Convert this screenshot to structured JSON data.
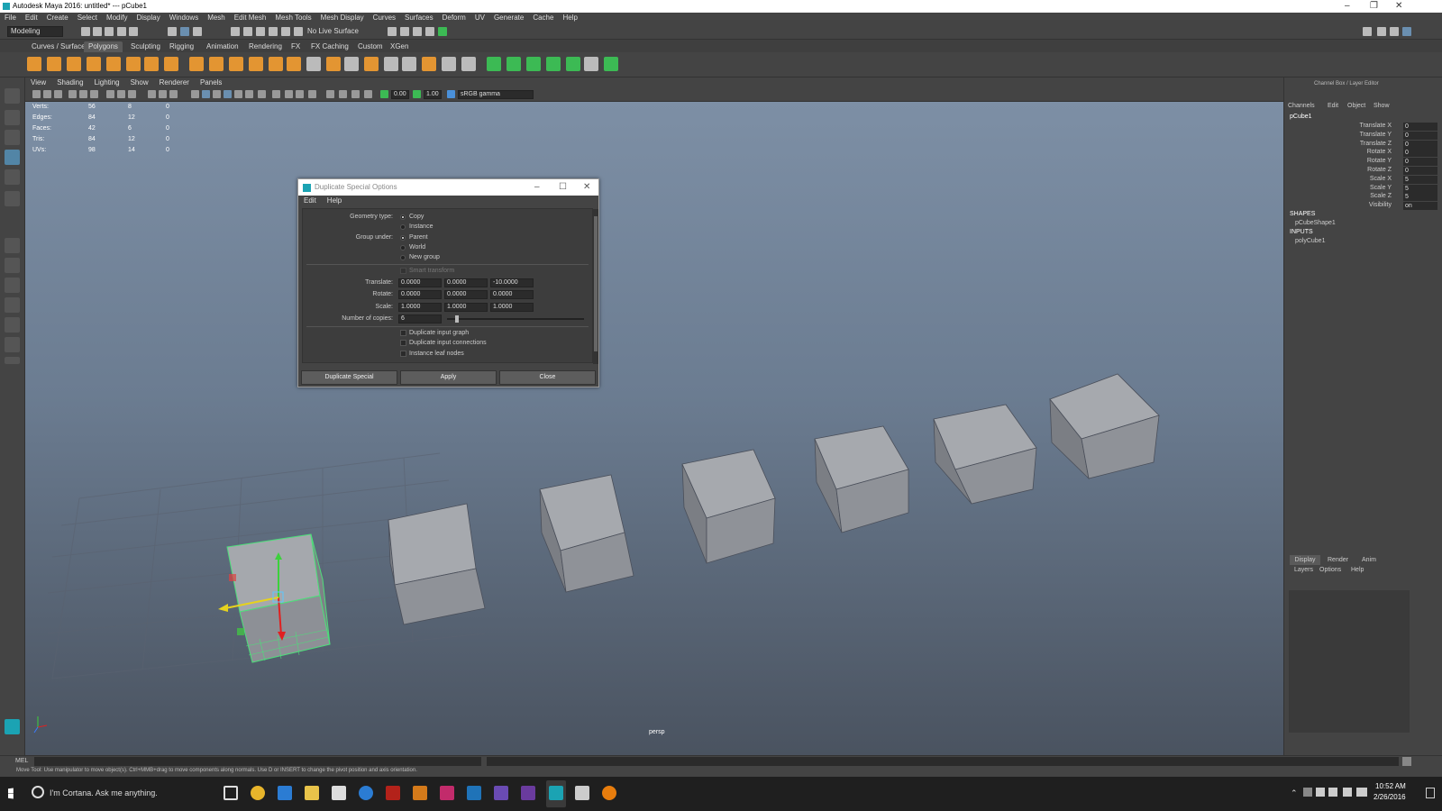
{
  "window": {
    "title": "Autodesk Maya 2016: untitled*   ---   pCube1"
  },
  "menubar": [
    "File",
    "Edit",
    "Create",
    "Select",
    "Modify",
    "Display",
    "Windows",
    "Mesh",
    "Edit Mesh",
    "Mesh Tools",
    "Mesh Display",
    "Curves",
    "Surfaces",
    "Deform",
    "UV",
    "Generate",
    "Cache",
    "Help"
  ],
  "status": {
    "menuset": "Modeling",
    "live": "No Live Surface"
  },
  "shelf_tabs": [
    "Curves / Surfaces",
    "Polygons",
    "Sculpting",
    "Rigging",
    "Animation",
    "Rendering",
    "FX",
    "FX Caching",
    "Custom",
    "XGen"
  ],
  "shelf_active": "Polygons",
  "viewport_menu": [
    "View",
    "Shading",
    "Lighting",
    "Show",
    "Renderer",
    "Panels"
  ],
  "viewport_toolbar": {
    "val1": "0.00",
    "val2": "1.00",
    "colorspace": "sRGB gamma"
  },
  "hud": [
    {
      "label": "Verts:",
      "a": "56",
      "b": "8",
      "c": "0"
    },
    {
      "label": "Edges:",
      "a": "84",
      "b": "12",
      "c": "0"
    },
    {
      "label": "Faces:",
      "a": "42",
      "b": "6",
      "c": "0"
    },
    {
      "label": "Tris:",
      "a": "84",
      "b": "12",
      "c": "0"
    },
    {
      "label": "UVs:",
      "a": "98",
      "b": "14",
      "c": "0"
    }
  ],
  "camera": "persp",
  "dialog": {
    "title": "Duplicate Special Options",
    "menu": [
      "Edit",
      "Help"
    ],
    "geometry_label": "Geometry type:",
    "geometry_options": [
      "Copy",
      "Instance"
    ],
    "group_label": "Group under:",
    "group_options": [
      "Parent",
      "World",
      "New group"
    ],
    "smart_transform": "Smart transform",
    "translate_label": "Translate:",
    "translate": [
      "0.0000",
      "0.0000",
      "-10.0000"
    ],
    "rotate_label": "Rotate:",
    "rotate": [
      "0.0000",
      "0.0000",
      "0.0000"
    ],
    "scale_label": "Scale:",
    "scale": [
      "1.0000",
      "1.0000",
      "1.0000"
    ],
    "copies_label": "Number of copies:",
    "copies": "6",
    "copies_fraction": 0.06,
    "checks": [
      "Duplicate input graph",
      "Duplicate input connections",
      "Instance leaf nodes"
    ],
    "buttons": [
      "Duplicate Special",
      "Apply",
      "Close"
    ]
  },
  "channelbox": {
    "title": "Channel Box / Layer Editor",
    "menu": [
      "Channels",
      "Edit",
      "Object",
      "Show"
    ],
    "object": "pCube1",
    "attrs": [
      {
        "n": "Translate X",
        "v": "0"
      },
      {
        "n": "Translate Y",
        "v": "0"
      },
      {
        "n": "Translate Z",
        "v": "0"
      },
      {
        "n": "Rotate X",
        "v": "0"
      },
      {
        "n": "Rotate Y",
        "v": "0"
      },
      {
        "n": "Rotate Z",
        "v": "0"
      },
      {
        "n": "Scale X",
        "v": "5"
      },
      {
        "n": "Scale Y",
        "v": "5"
      },
      {
        "n": "Scale Z",
        "v": "5"
      },
      {
        "n": "Visibility",
        "v": "on"
      }
    ],
    "shapes_h": "SHAPES",
    "shape": "pCubeShape1",
    "inputs_h": "INPUTS",
    "input": "polyCube1",
    "layer_tabs": [
      "Display",
      "Render",
      "Anim"
    ],
    "layer_menu": [
      "Layers",
      "Options",
      "Help"
    ]
  },
  "cmd": {
    "label": "MEL"
  },
  "helpline": "Move Tool: Use manipulator to move object(s). Ctrl+MMB+drag to move components along normals. Use D or INSERT to change the pivot position and axis orientation.",
  "taskbar": {
    "search": "I'm Cortana. Ask me anything.",
    "time": "10:52 AM",
    "date": "2/26/2016"
  }
}
